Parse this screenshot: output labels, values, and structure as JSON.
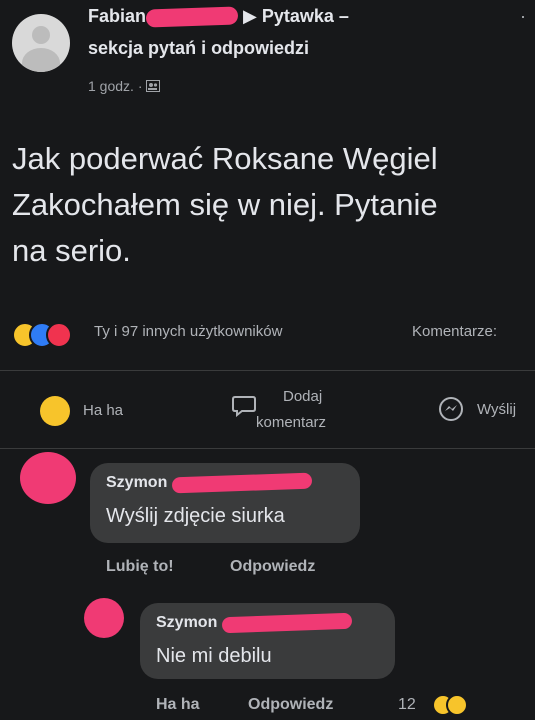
{
  "post": {
    "author": "Fabian",
    "group_arrow": "▶",
    "group_name": "Pytawka –",
    "group_name_line2": "sekcja pytań i odpowiedzi",
    "time": "1 godz. ·",
    "more": "·",
    "text_lines": [
      "Jak poderwać Roksane Węgiel",
      "Zakochałem się w niej. Pytanie",
      "na serio."
    ],
    "reactions_text": "Ty i 97 innych użytkowników",
    "comments_count": "Komentarze:"
  },
  "actions": {
    "haha_label": "Ha ha",
    "comment_label_line1": "Dodaj",
    "comment_label_line2": "komentarz",
    "share_label": "Wyślij"
  },
  "comments": [
    {
      "author": "Szymon",
      "text": "Wyślij zdjęcie siurka",
      "like_label": "Lubię to!",
      "reply_label": "Odpowiedz"
    },
    {
      "author": "Szymon",
      "text": "Nie mi debilu",
      "haha_label": "Ha ha",
      "reply_label": "Odpowiedz",
      "reaction_count": "12"
    }
  ],
  "colors": {
    "background": "#17181a",
    "bubble": "#3a3b3c",
    "redaction": "#f03a74",
    "haha_yellow": "#f7c42b",
    "like_blue": "#2f7cf6",
    "love_red": "#f0334f"
  },
  "icons": {
    "haha": "haha-emoji-icon",
    "like": "like-thumb-icon",
    "love": "love-heart-icon",
    "comment": "comment-bubble-icon",
    "share": "messenger-icon",
    "privacy": "group-privacy-icon"
  }
}
